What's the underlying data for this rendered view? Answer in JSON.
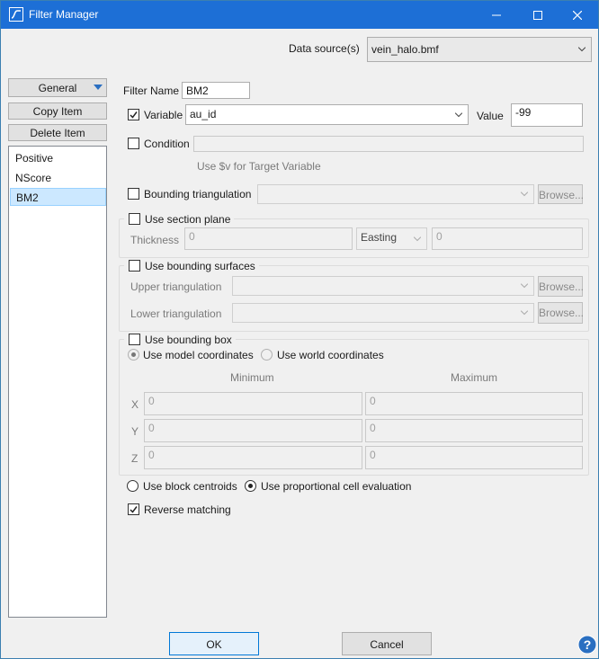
{
  "window": {
    "title": "Filter Manager"
  },
  "data_source": {
    "label": "Data source(s)",
    "value": "vein_halo.bmf"
  },
  "left_panel": {
    "general_label": "General",
    "copy_label": "Copy Item",
    "delete_label": "Delete Item",
    "items": [
      {
        "label": "Positive"
      },
      {
        "label": "NScore"
      },
      {
        "label": "BM2"
      }
    ]
  },
  "filter": {
    "name_label": "Filter Name",
    "name_value": "BM2",
    "variable_label": "Variable",
    "variable_value": "au_id",
    "value_label": "Value",
    "value_value": "-99",
    "condition_label": "Condition",
    "condition_hint": "Use $v for Target Variable",
    "bounding_triangulation_label": "Bounding triangulation",
    "browse_label": "Browse..."
  },
  "section_plane": {
    "label": "Use section plane",
    "thickness_label": "Thickness",
    "thickness_value": "0",
    "direction_value": "Easting",
    "offset_value": "0"
  },
  "bounding_surfaces": {
    "label": "Use bounding surfaces",
    "upper_label": "Upper triangulation",
    "lower_label": "Lower triangulation"
  },
  "bounding_box": {
    "label": "Use bounding box",
    "model_coords_label": "Use model coordinates",
    "world_coords_label": "Use world coordinates",
    "min_header": "Minimum",
    "max_header": "Maximum",
    "rows": [
      {
        "axis": "X",
        "min": "0",
        "max": "0"
      },
      {
        "axis": "Y",
        "min": "0",
        "max": "0"
      },
      {
        "axis": "Z",
        "min": "0",
        "max": "0"
      }
    ]
  },
  "evaluation": {
    "centroids_label": "Use block centroids",
    "proportional_label": "Use proportional cell evaluation"
  },
  "reverse_label": "Reverse matching",
  "footer": {
    "ok_label": "OK",
    "cancel_label": "Cancel"
  },
  "colors": {
    "titlebar": "#1d6fd6",
    "selection": "#cce8ff",
    "help": "#2a6fc1"
  }
}
